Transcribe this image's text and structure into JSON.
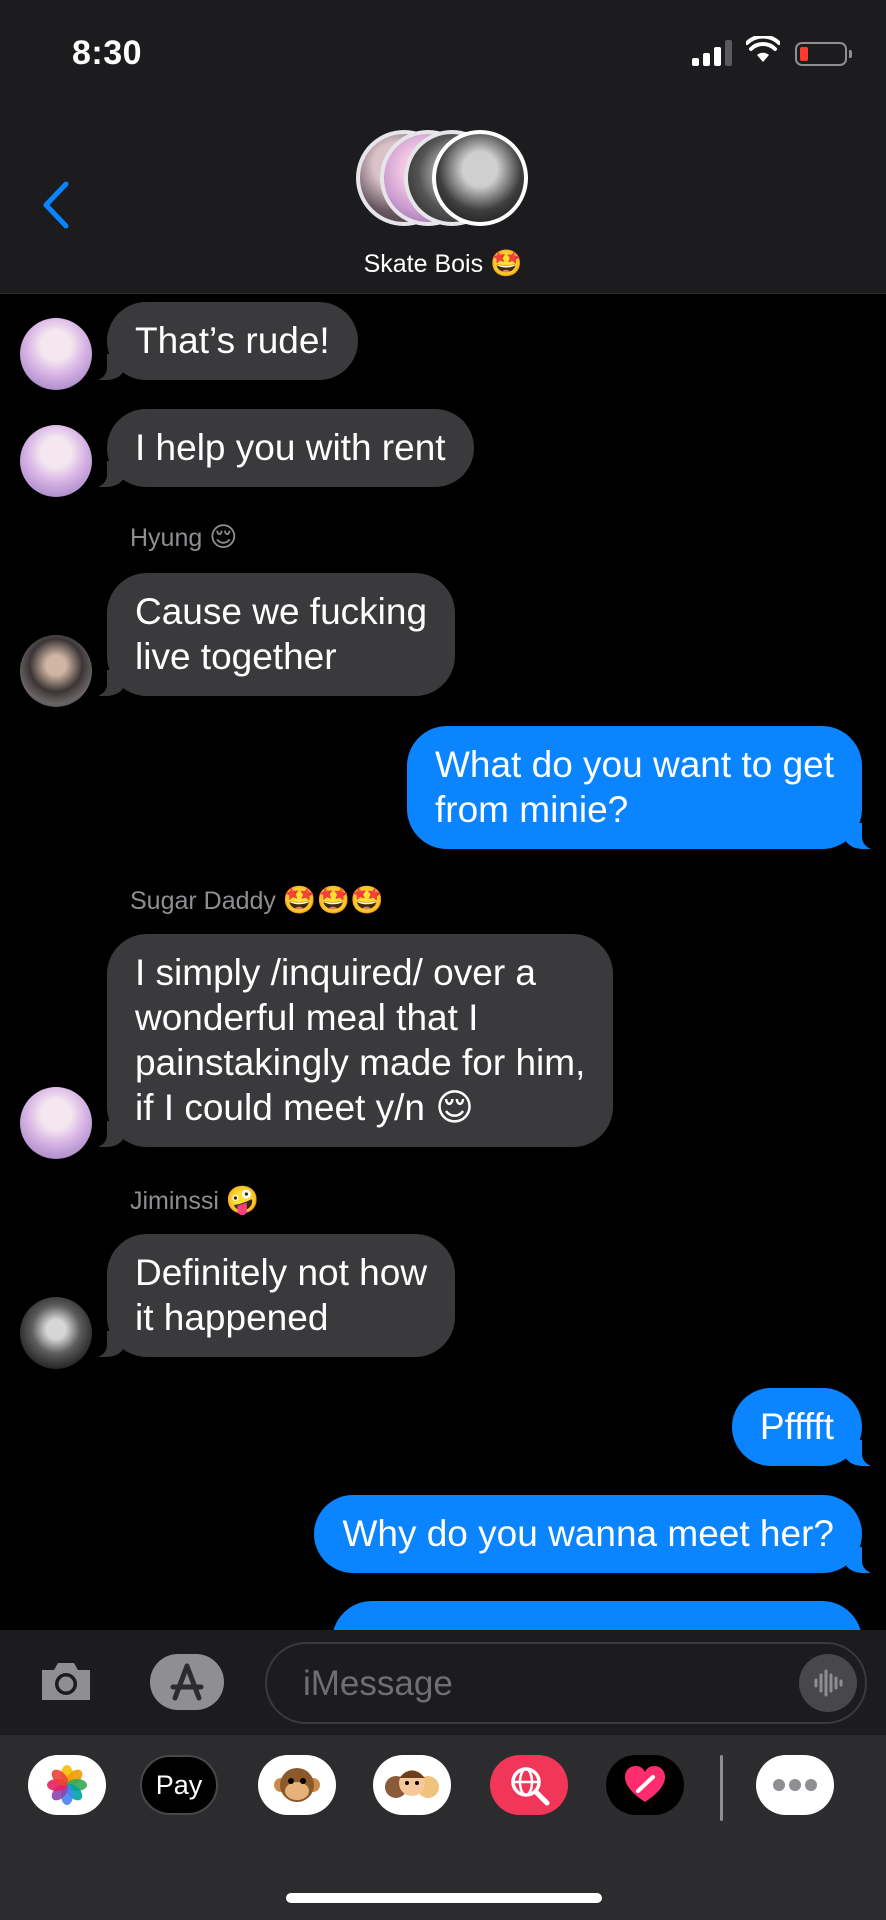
{
  "status_bar": {
    "time": "8:30"
  },
  "header": {
    "group_name": "Skate Bois",
    "group_emoji": "🤩"
  },
  "messages": [
    {
      "text": "That’s rude!"
    },
    {
      "text": "I help you with rent"
    },
    {
      "sender": "Hyung",
      "sender_emoji": "😌",
      "text_lines": [
        "Cause we fucking",
        "live together"
      ]
    },
    {
      "text_lines": [
        "What do you want to get",
        "from minie?"
      ]
    },
    {
      "sender": "Sugar Daddy",
      "sender_emoji": "🤩🤩🤩",
      "text_lines": [
        "I simply /inquired/ over a",
        "wonderful meal that I",
        "painstakingly made for him,",
        "if I could meet y/n 😌"
      ]
    },
    {
      "sender": "Jiminssi",
      "sender_emoji": "🤪",
      "text_lines": [
        "Definitely not how",
        "it happened"
      ]
    },
    {
      "text": "Pfffft"
    },
    {
      "text": "Why do you wanna meet her?"
    }
  ],
  "composer": {
    "placeholder": "iMessage"
  },
  "app_drawer": {
    "apple_pay_label": "Pay",
    "apple_pay_symbol": ""
  },
  "colors": {
    "sent_bubble": "#0a84ff",
    "received_bubble": "#3a3a3c",
    "accent": "#0a84ff"
  }
}
